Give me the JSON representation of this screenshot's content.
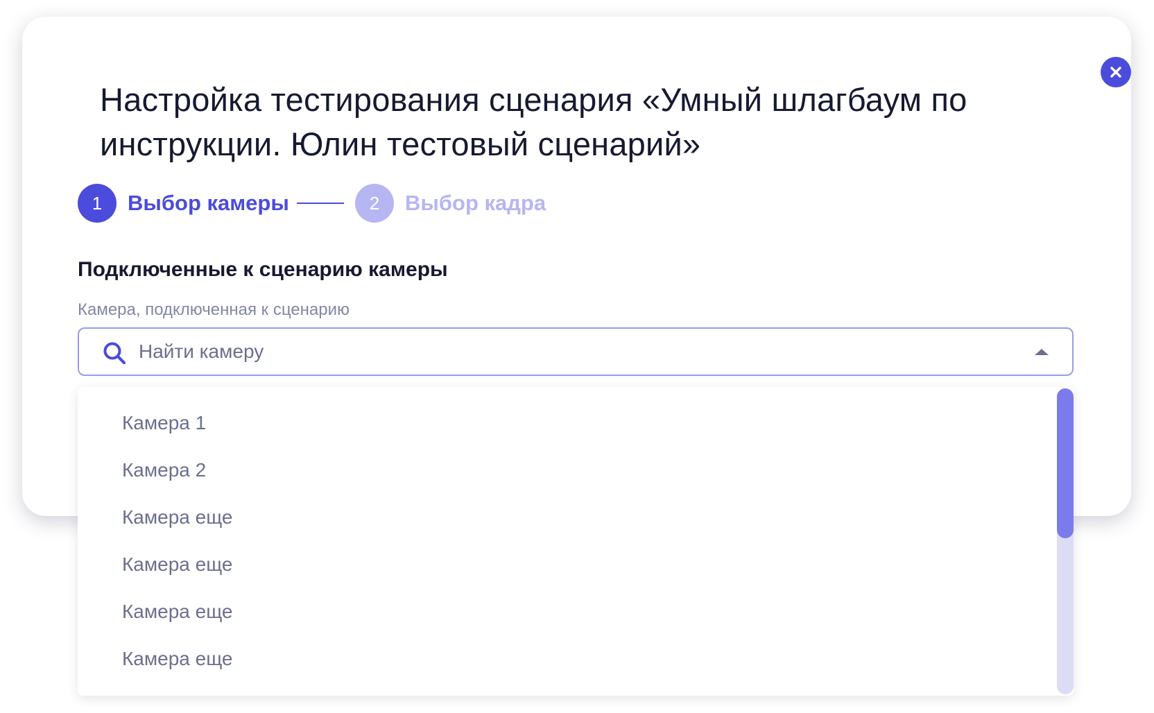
{
  "modal": {
    "title": "Настройка тестирования сценария «Умный шлагбаум по инструкции. Юлин тестовый сценарий»",
    "close_icon": "close-icon"
  },
  "stepper": {
    "steps": [
      {
        "number": "1",
        "label": "Выбор камеры",
        "state": "active"
      },
      {
        "number": "2",
        "label": "Выбор кадра",
        "state": "inactive"
      }
    ]
  },
  "section": {
    "title": "Подключенные к сценарию камеры",
    "field_label": "Камера, подключенная к сценарию",
    "search": {
      "placeholder": "Найти камеру",
      "value": "",
      "icon": "search-icon",
      "toggle_icon": "caret-up-icon"
    }
  },
  "dropdown": {
    "items": [
      "Камера 1",
      "Камера 2",
      "Камера еще",
      "Камера еще",
      "Камера еще",
      "Камера еще"
    ]
  },
  "colors": {
    "accent": "#4b4bdc",
    "accent_light": "#b6b6f2",
    "text_dark": "#151a30",
    "text_muted": "#6b6f8e",
    "scroll_thumb": "#7b7bed",
    "scroll_track": "#dcdcf5"
  }
}
